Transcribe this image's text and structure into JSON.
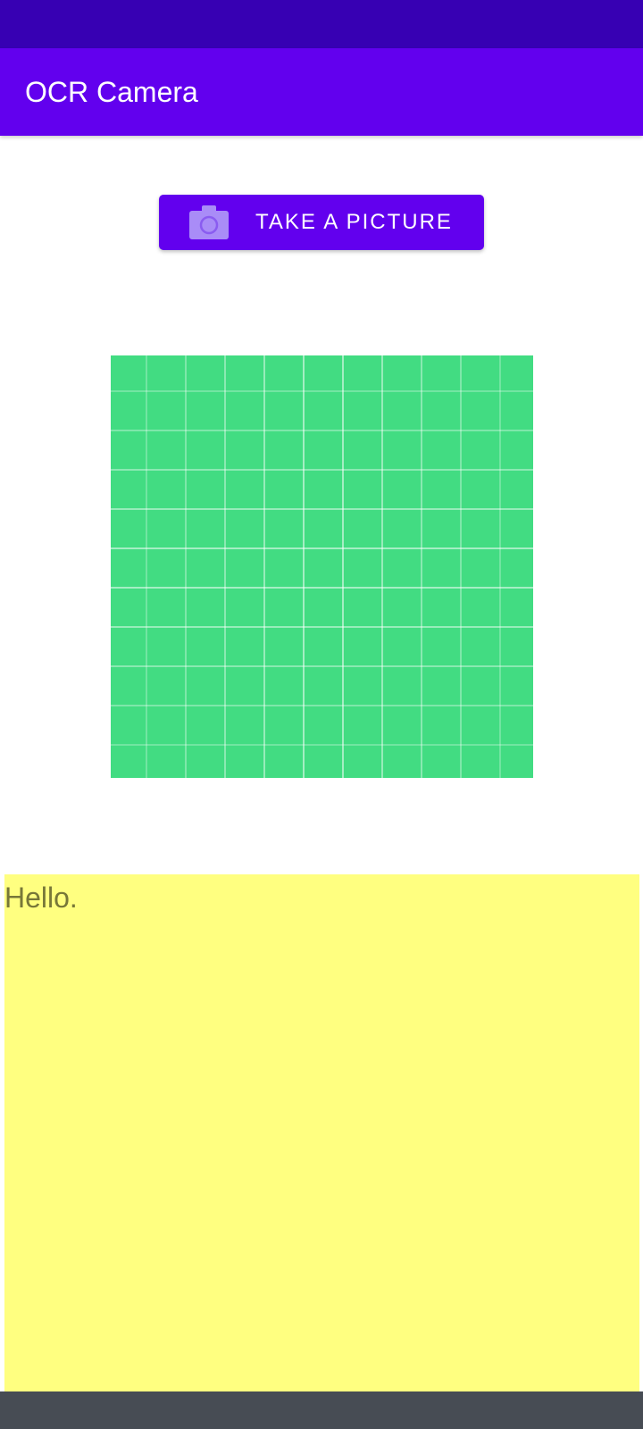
{
  "app": {
    "title": "OCR Camera"
  },
  "actions": {
    "take_picture_label": "TAKE A PICTURE",
    "take_picture_icon": "camera-icon"
  },
  "preview": {
    "icon": "image-grid-placeholder",
    "color": "#42dc82"
  },
  "result": {
    "text": "Hello."
  },
  "colors": {
    "primary": "#6200ee",
    "primary_dark": "#3700b3",
    "result_background": "#ffff80"
  }
}
